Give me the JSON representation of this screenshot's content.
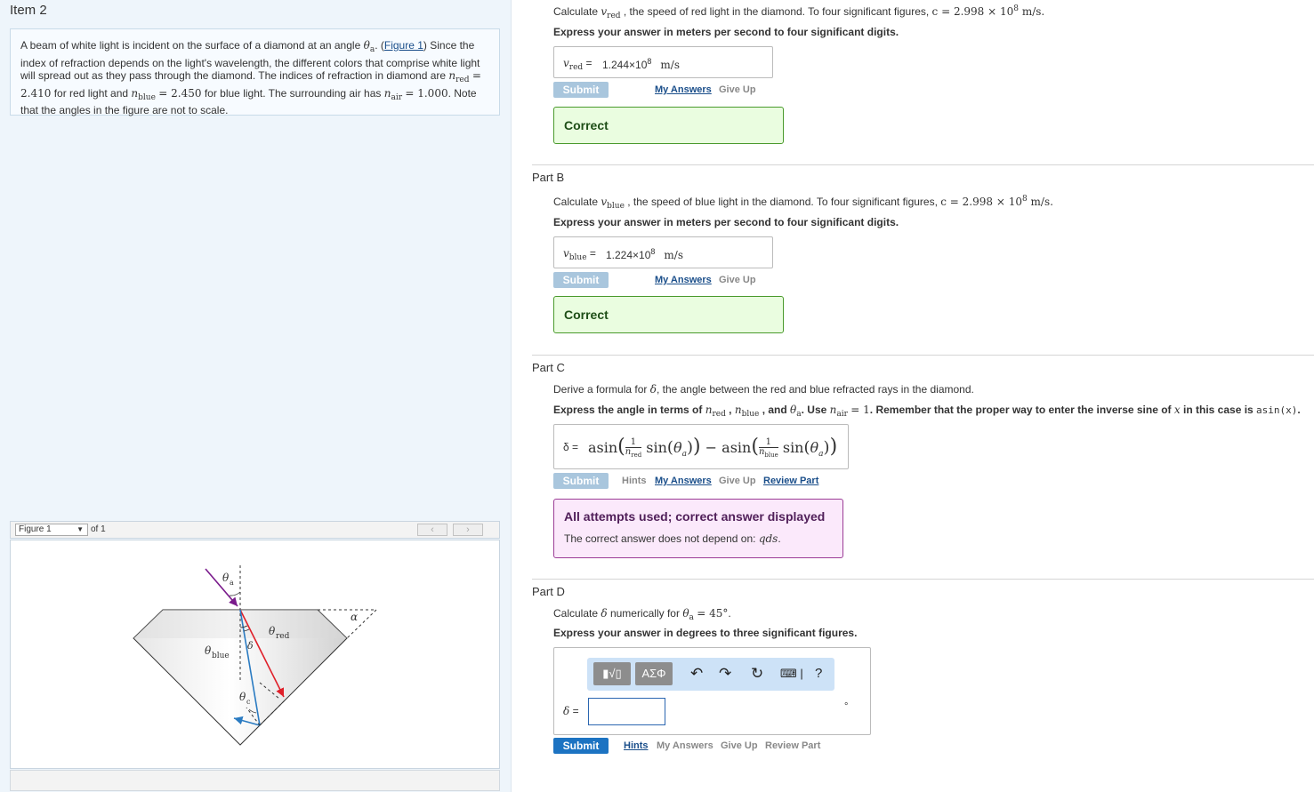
{
  "item": {
    "title": "Item 2"
  },
  "intro": {
    "t1": "A beam of white light is incident on the surface of a diamond at an angle ",
    "t2": ". (",
    "figure_link": "Figure 1",
    "t3": ") Since the index of refraction depends on the light's wavelength, the different colors that comprise white light will spread out as they pass through the diamond. The indices of refraction in diamond are ",
    "n_red_val": "= 2.410",
    "t4": " for red light and ",
    "n_blue_val": "= 2.450",
    "t5": " for blue light. The surrounding air has ",
    "n_air_val": "= 1.000",
    "t6": ". Note that the angles in the figure are not to scale."
  },
  "figure": {
    "select_label": "Figure 1",
    "of_label": "of 1",
    "prev_icon": "chevron-left",
    "next_icon": "chevron-right"
  },
  "partA": {
    "q_pre": "Calculate ",
    "q_post": " , the speed of red light in the diamond. To four significant figures, ",
    "c_eq": "c = 2.998 × 10",
    "c_exp": "8",
    "c_unit": " m/s.",
    "instr": "Express your answer in meters per second to four significant digits.",
    "answer_label": "=",
    "answer_mant": "1.244×10",
    "answer_exp": "8",
    "answer_unit": "m/s",
    "submit": "Submit",
    "my_answers": "My Answers",
    "give_up": "Give Up",
    "feedback": "Correct"
  },
  "partB": {
    "title": "Part B",
    "q_pre": "Calculate ",
    "q_post": " , the speed of blue light in the diamond. To four significant figures, ",
    "c_eq": "c = 2.998 × 10",
    "c_exp": "8",
    "c_unit": " m/s.",
    "instr": "Express your answer in meters per second to four significant digits.",
    "answer_label": "=",
    "answer_mant": "1.224×10",
    "answer_exp": "8",
    "answer_unit": "m/s",
    "submit": "Submit",
    "my_answers": "My Answers",
    "give_up": "Give Up",
    "feedback": "Correct"
  },
  "partC": {
    "title": "Part C",
    "q_pre": "Derive a formula for ",
    "q_post": ", the angle between the red and blue refracted rays in the diamond.",
    "instr_pre": "Express the angle in terms of ",
    "instr_mid": ". Use ",
    "instr_eq": "= 1",
    "instr_post": ". Remember that the proper way to enter the inverse sine of ",
    "instr_x": "x",
    "instr_tail": " in this case is ",
    "instr_code": "asin(x)",
    "answer_label": "δ =",
    "submit": "Submit",
    "hints": "Hints",
    "my_answers": "My Answers",
    "give_up": "Give Up",
    "review": "Review Part",
    "attempts_title": "All attempts used; correct answer displayed",
    "attempts_text": "The correct answer does not depend on: ",
    "attempts_var": "qds"
  },
  "partD": {
    "title": "Part D",
    "q_pre": "Calculate ",
    "q_mid": " numerically for ",
    "q_val": "= 45°",
    "instr": "Express your answer in degrees to three significant figures.",
    "toolbar_templates_icon": "templates-icon",
    "toolbar_greek": "ΑΣΦ",
    "help": "?",
    "answer_label": "δ =",
    "input_value": "",
    "unit": "°",
    "submit": "Submit",
    "hints": "Hints",
    "my_answers": "My Answers",
    "give_up": "Give Up",
    "review": "Review Part"
  }
}
